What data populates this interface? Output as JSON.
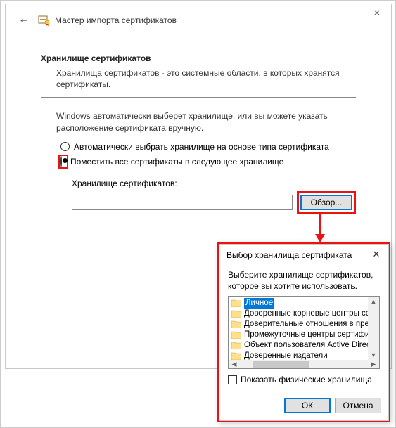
{
  "wizard": {
    "title": "Мастер импорта сертификатов",
    "section_heading": "Хранилище сертификатов",
    "section_desc": "Хранилища сертификатов - это системные области, в которых хранятся сертификаты.",
    "instruction": "Windows автоматически выберет хранилище, или вы можете указать расположение сертификата вручную.",
    "radio_auto": "Автоматически выбрать хранилище на основе типа сертификата",
    "radio_place": "Поместить все сертификаты в следующее хранилище",
    "store_label": "Хранилище сертификатов:",
    "store_value": "",
    "browse_label": "Обзор..."
  },
  "popup": {
    "title": "Выбор хранилища сертификата",
    "instruction": "Выберите хранилище сертификатов, которое вы хотите использовать.",
    "items": [
      "Личное",
      "Доверенные корневые центры сертифика",
      "Доверительные отношения в предприяти",
      "Промежуточные центры сертификации",
      "Объект пользователя Active Directory",
      "Доверенные издатели"
    ],
    "show_physical": "Показать физические хранилища",
    "ok": "ОК",
    "cancel": "Отмена"
  }
}
